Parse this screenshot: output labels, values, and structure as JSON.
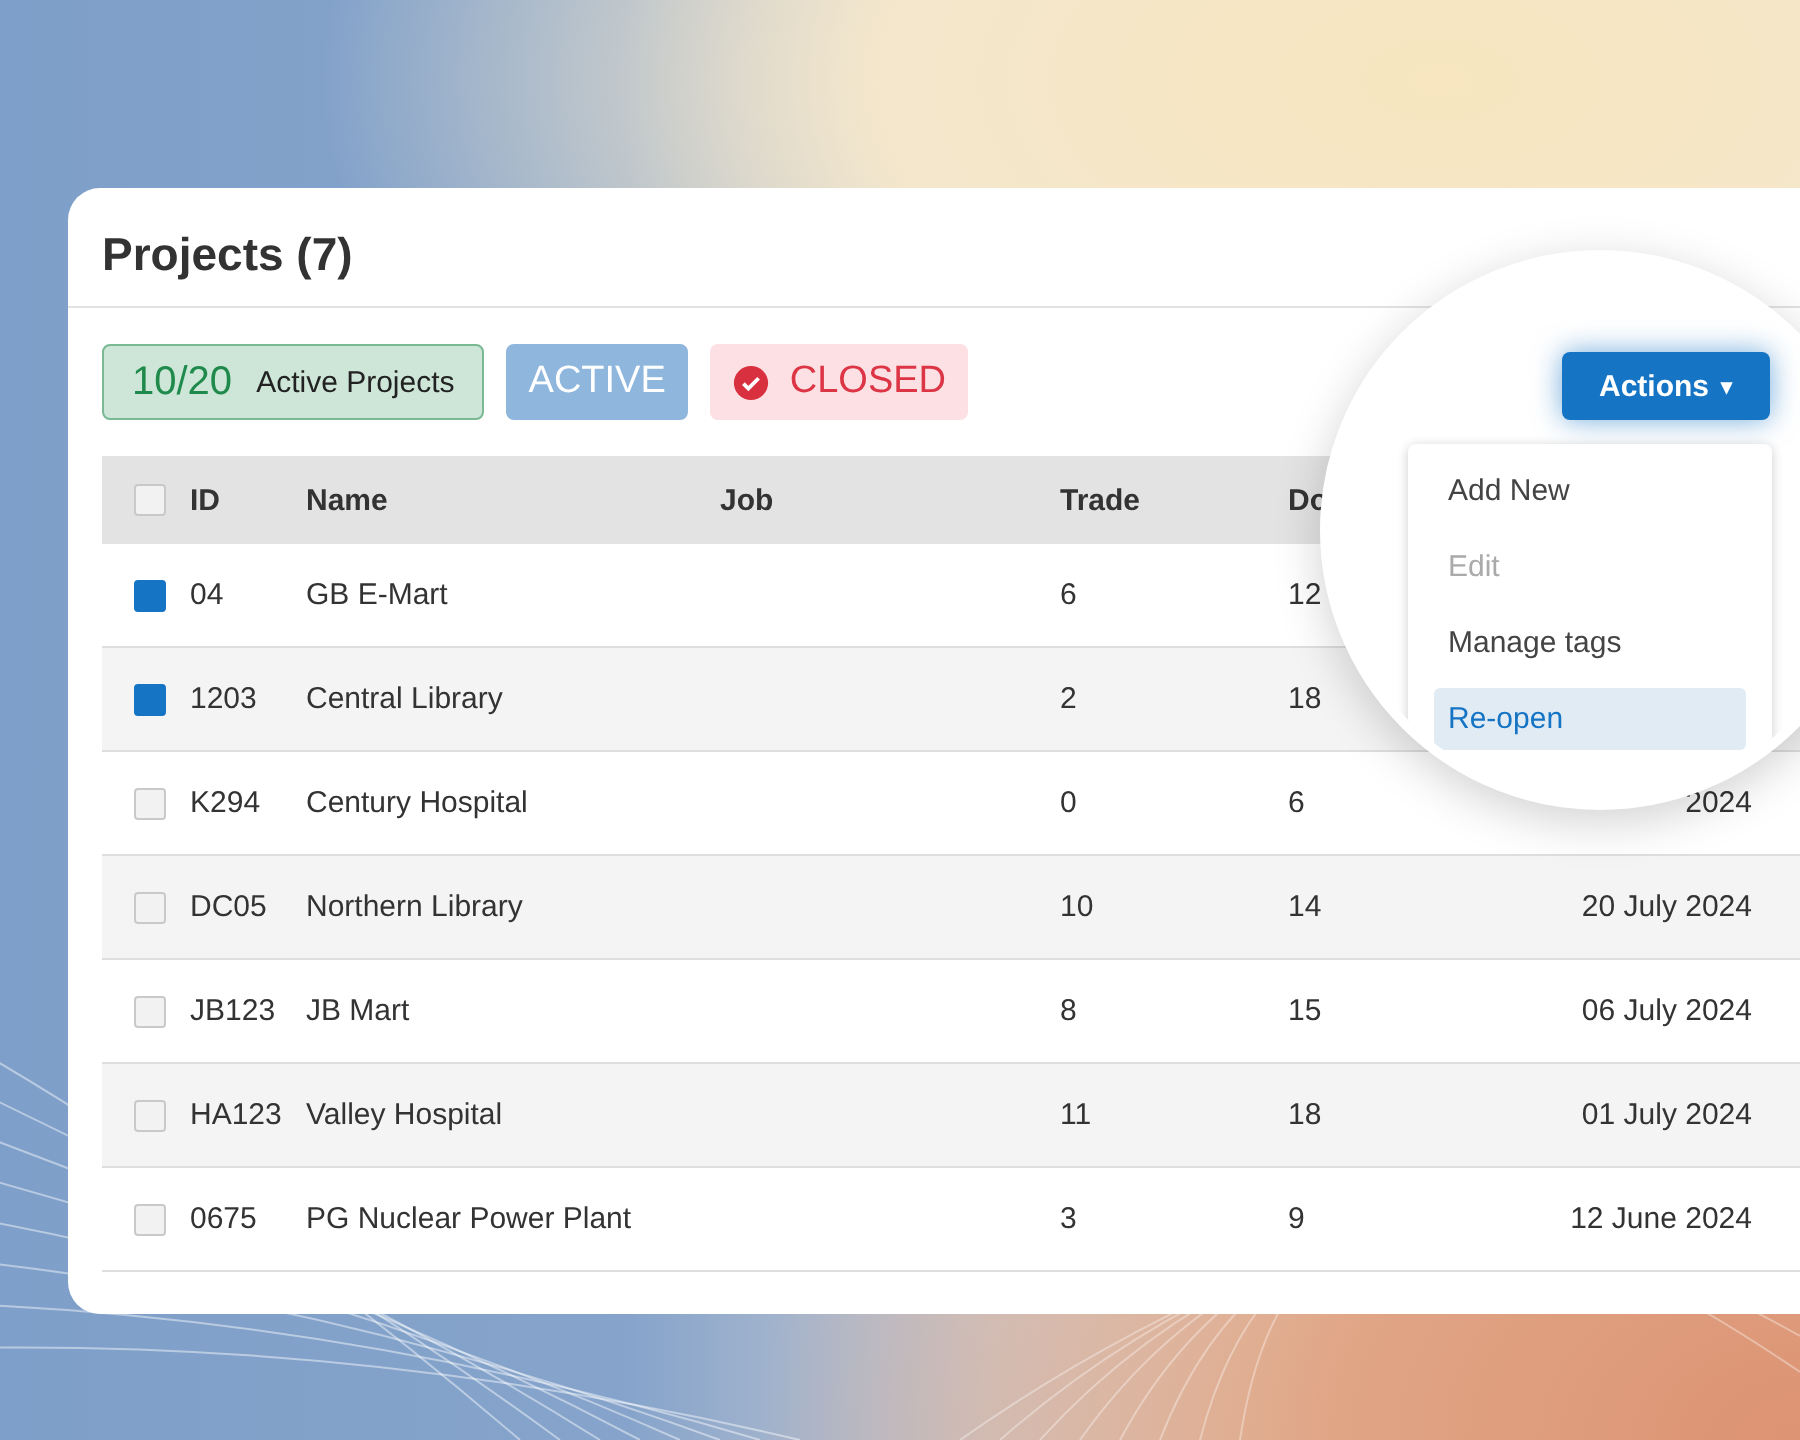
{
  "card": {
    "title": "Projects (7)"
  },
  "summary": {
    "count": "10/20",
    "label": "Active Projects"
  },
  "filters": [
    {
      "label": "ACTIVE",
      "selected": false
    },
    {
      "label": "CLOSED",
      "selected": true
    }
  ],
  "actions": {
    "label": "Actions",
    "caret": "▾"
  },
  "menu": [
    {
      "label": "Add New",
      "disabled": false,
      "selected": false
    },
    {
      "label": "Edit",
      "disabled": true,
      "selected": false
    },
    {
      "label": "Manage tags",
      "disabled": false,
      "selected": false
    },
    {
      "label": "Re-open",
      "disabled": false,
      "selected": true
    }
  ],
  "table": {
    "select_all": {
      "checked": false
    },
    "columns": [
      "ID",
      "Name",
      "Job",
      "Trade",
      "Do"
    ],
    "rows": [
      {
        "selected": true,
        "id": "04",
        "name": "GB E-Mart",
        "trade": "6",
        "column_5": "12"
      },
      {
        "selected": true,
        "id": "1203",
        "name": "Central Library",
        "trade": "2",
        "column_5": "18"
      },
      {
        "selected": false,
        "id": "K294",
        "name": "Century Hospital",
        "trade": "0",
        "column_5": "6",
        "date": "2024"
      },
      {
        "selected": false,
        "id": "DC05",
        "name": "Northern Library",
        "trade": "10",
        "column_5": "14",
        "date": "20 July 2024"
      },
      {
        "selected": false,
        "id": "JB123",
        "name": "JB Mart",
        "trade": "8",
        "column_5": "15",
        "date": "06 July 2024"
      },
      {
        "selected": false,
        "id": "HA123",
        "name": "Valley Hospital",
        "trade": "11",
        "column_5": "18",
        "date": "01 July 2024"
      },
      {
        "selected": false,
        "id": "0675",
        "name": "PG Nuclear Power Plant",
        "trade": "3",
        "column_5": "9",
        "date": "12 June 2024"
      }
    ]
  }
}
